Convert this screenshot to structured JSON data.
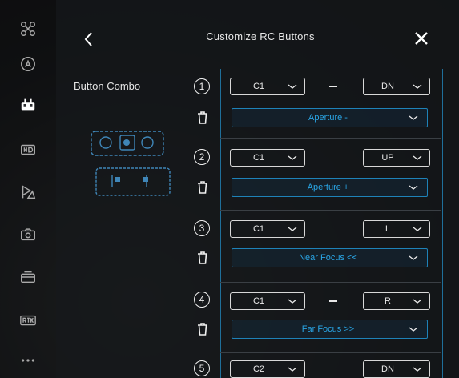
{
  "header": {
    "title": "Customize RC Buttons"
  },
  "combo_label": "Button Combo",
  "sidebar": {
    "items": [
      {
        "icon": "drone-icon"
      },
      {
        "icon": "flight-mode-icon"
      },
      {
        "icon": "remote-controller-icon",
        "active": true
      },
      {
        "icon": "hd-transmission-icon"
      },
      {
        "icon": "visual-navigation-icon"
      },
      {
        "icon": "camera-icon"
      },
      {
        "icon": "battery-icon"
      },
      {
        "icon": "rtk-icon"
      },
      {
        "icon": "more-icon"
      }
    ]
  },
  "rows": [
    {
      "num": "1",
      "button": "C1",
      "combo": "DN",
      "function": "Aperture -"
    },
    {
      "num": "2",
      "button": "C1",
      "combo": "UP",
      "function": "Aperture +"
    },
    {
      "num": "3",
      "button": "C1",
      "combo": "L",
      "function": "Near Focus <<"
    },
    {
      "num": "4",
      "button": "C1",
      "combo": "R",
      "function": "Far Focus >>"
    },
    {
      "num": "5",
      "button": "C2",
      "combo": "DN"
    }
  ],
  "colors": {
    "accent": "#1e82b8",
    "accent_text": "#2aa6e6",
    "text": "#e8e8e8"
  }
}
